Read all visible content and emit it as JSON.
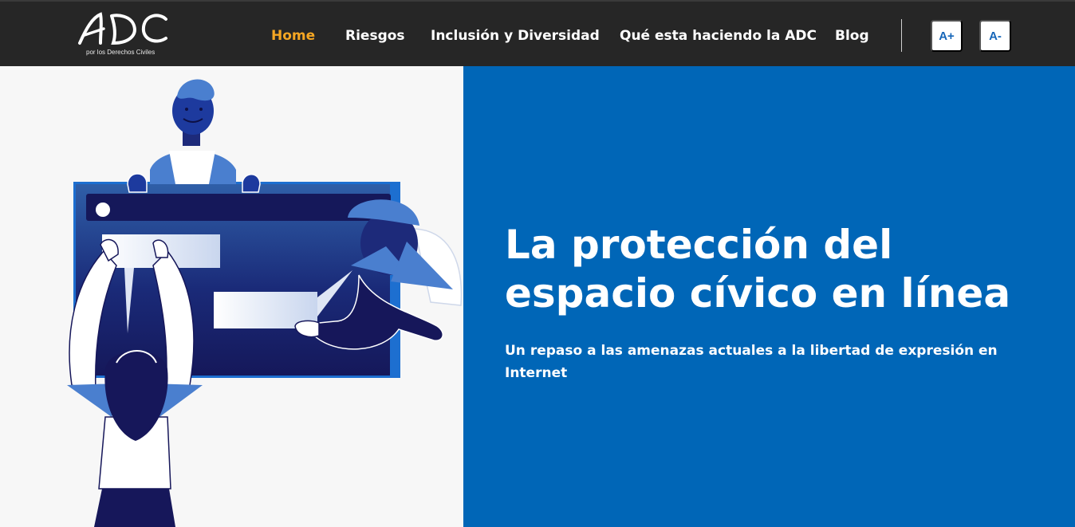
{
  "brand": {
    "logo_text": "ADC",
    "tagline": "por los Derechos Civiles"
  },
  "nav": {
    "items": [
      {
        "label": "Home",
        "active": true
      },
      {
        "label": "Riesgos",
        "active": false
      },
      {
        "label": "Inclusión y Diversidad",
        "active": false
      },
      {
        "label": "Qué esta haciendo la ADC",
        "active": false
      },
      {
        "label": "Blog",
        "active": false
      }
    ],
    "font_increase_label": "A+",
    "font_decrease_label": "A-"
  },
  "hero": {
    "title": "La protección del espacio cívico en línea",
    "subtitle": "Un repaso a las amenazas actuales a la libertad de expresión en Internet",
    "illustration_icon": "people-around-browser-window-illustration"
  },
  "colors": {
    "nav_background": "#262626",
    "active_link": "#f5a623",
    "hero_blue": "#0066b7",
    "illustration_navy": "#16175a",
    "illustration_blue": "#4a7fcf"
  }
}
